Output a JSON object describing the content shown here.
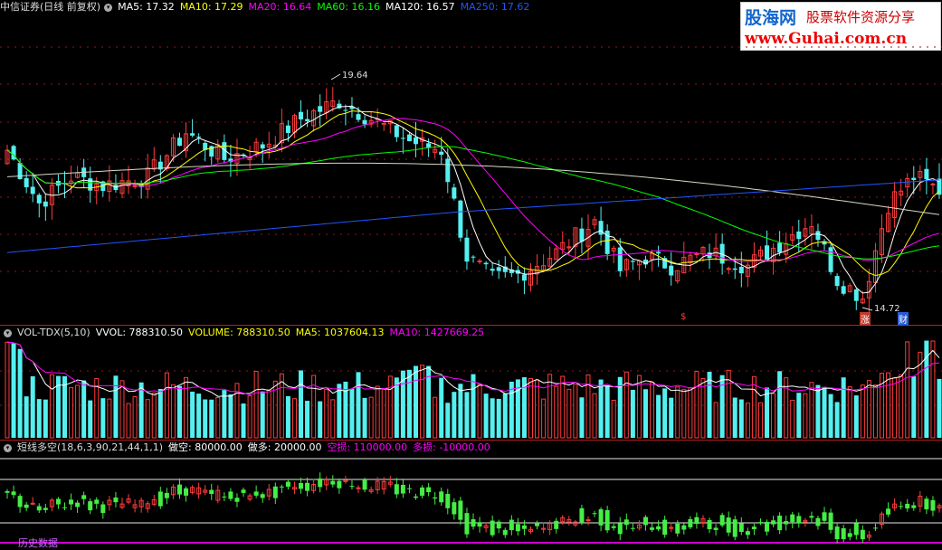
{
  "main_header": {
    "title": "中信证券(日线 前复权)",
    "items": [
      {
        "text": "MA5: 17.32",
        "color": "#ffffff"
      },
      {
        "text": "MA10: 17.29",
        "color": "#ffff00"
      },
      {
        "text": "MA20: 16.64",
        "color": "#ff00ff"
      },
      {
        "text": "MA60: 16.16",
        "color": "#00ff00"
      },
      {
        "text": "MA120: 16.57",
        "color": "#ffffff"
      },
      {
        "text": "MA250: 17.62",
        "color": "#2255ff"
      }
    ]
  },
  "vol_header": {
    "title": "VOL-TDX(5,10)",
    "items": [
      {
        "text": "VVOL: 788310.50",
        "color": "#ffffff"
      },
      {
        "text": "VOLUME: 788310.50",
        "color": "#ffff00"
      },
      {
        "text": "MA5: 1037604.13",
        "color": "#ffff00"
      },
      {
        "text": "MA10: 1427669.25",
        "color": "#ff00ff"
      }
    ]
  },
  "ind_header": {
    "title": "短线多空(18,6,3,90,21,44,1,1)",
    "items": [
      {
        "text": "做空: 80000.00",
        "color": "#ffffff"
      },
      {
        "text": "做多: 20000.00",
        "color": "#ffffff"
      },
      {
        "text": "空损: 110000.00",
        "color": "#ff00ff"
      },
      {
        "text": "多损: -10000.00",
        "color": "#ff00ff"
      }
    ]
  },
  "watermark": {
    "cn_name": "股海网",
    "slogan": "股票软件资源分享",
    "url": "www.Guhai.com.cn"
  },
  "annotations": {
    "high": "19.64",
    "low": "14.72",
    "event_zhang": "涨",
    "event_cai": "财",
    "event_s": "$"
  },
  "bottom_text": "历史数据",
  "chart_data": [
    {
      "type": "candlestick",
      "panel": "price",
      "n_bars": 147,
      "ylim": [
        14.3,
        21.2
      ],
      "highest": 19.64,
      "lowest": 14.72,
      "series": [
        {
          "name": "MA5",
          "last": 17.32,
          "color": "#ffffff"
        },
        {
          "name": "MA10",
          "last": 17.29,
          "color": "#ffff00"
        },
        {
          "name": "MA20",
          "last": 16.64,
          "color": "#ff00ff"
        },
        {
          "name": "MA60",
          "last": 16.16,
          "color": "#00ff00"
        },
        {
          "name": "MA120",
          "last": 16.57,
          "color": "#ffffff"
        },
        {
          "name": "MA250",
          "last": 17.62,
          "color": "#2255ff"
        }
      ],
      "close_anchors": [
        [
          0,
          18.2
        ],
        [
          5,
          17.0
        ],
        [
          10,
          17.6
        ],
        [
          15,
          17.4
        ],
        [
          22,
          17.6
        ],
        [
          28,
          18.6
        ],
        [
          34,
          18.0
        ],
        [
          40,
          18.3
        ],
        [
          46,
          18.9
        ],
        [
          52,
          19.3
        ],
        [
          57,
          18.9
        ],
        [
          63,
          18.4
        ],
        [
          68,
          18.2
        ],
        [
          72,
          15.8
        ],
        [
          76,
          15.3
        ],
        [
          80,
          15.4
        ],
        [
          86,
          15.9
        ],
        [
          92,
          16.6
        ],
        [
          96,
          15.5
        ],
        [
          100,
          15.8
        ],
        [
          104,
          15.6
        ],
        [
          110,
          15.9
        ],
        [
          116,
          15.6
        ],
        [
          122,
          16.2
        ],
        [
          126,
          16.6
        ],
        [
          130,
          15.3
        ],
        [
          134,
          14.9
        ],
        [
          138,
          17.0
        ],
        [
          142,
          17.6
        ],
        [
          146,
          17.3
        ]
      ]
    },
    {
      "type": "bar",
      "panel": "volume",
      "series": [
        {
          "name": "VVOL",
          "last": 788310.5
        },
        {
          "name": "VOLUME",
          "last": 788310.5
        },
        {
          "name": "MA5",
          "last": 1037604.13
        },
        {
          "name": "MA10",
          "last": 1427669.25
        }
      ]
    },
    {
      "type": "candlestick",
      "panel": "indicator",
      "params": "18,6,3,90,21,44,1,1",
      "series": [
        {
          "name": "做空",
          "last": 80000.0
        },
        {
          "name": "做多",
          "last": 20000.0
        },
        {
          "name": "空损",
          "last": 110000.0
        },
        {
          "name": "多损",
          "last": -10000.0
        }
      ]
    }
  ]
}
